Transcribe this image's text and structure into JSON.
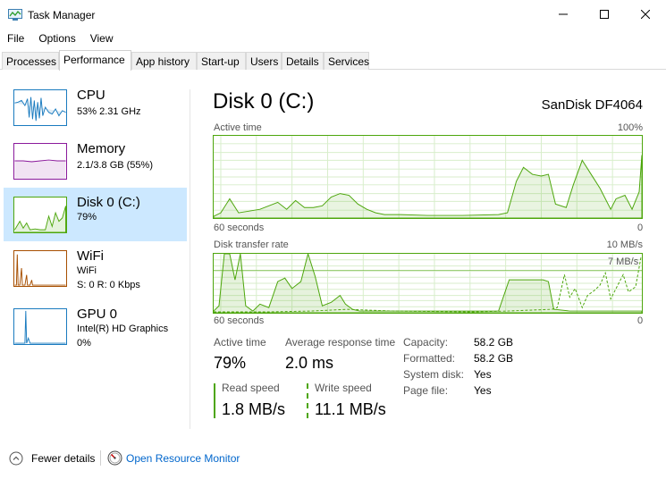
{
  "window": {
    "title": "Task Manager"
  },
  "menu": [
    "File",
    "Options",
    "View"
  ],
  "tabs": [
    "Processes",
    "Performance",
    "App history",
    "Start-up",
    "Users",
    "Details",
    "Services"
  ],
  "sidebar": {
    "items": [
      {
        "name": "CPU",
        "line1": "53% 2.31 GHz",
        "line2": ""
      },
      {
        "name": "Memory",
        "line1": "2.1/3.8 GB (55%)",
        "line2": ""
      },
      {
        "name": "Disk 0 (C:)",
        "line1": "79%",
        "line2": ""
      },
      {
        "name": "WiFi",
        "line1": "WiFi",
        "line2": "S: 0 R: 0 Kbps"
      },
      {
        "name": "GPU 0",
        "line1": "Intel(R) HD Graphics",
        "line2": "0%"
      }
    ]
  },
  "main": {
    "title": "Disk 0 (C:)",
    "model": "SanDisk DF4064",
    "graph1": {
      "label": "Active time",
      "max": "100%",
      "time": "60 seconds",
      "min": "0"
    },
    "graph2": {
      "label": "Disk transfer rate",
      "max": "10 MB/s",
      "marker": "7 MB/s",
      "time": "60 seconds",
      "min": "0"
    },
    "stats": {
      "active_time_label": "Active time",
      "active_time_value": "79%",
      "avg_response_label": "Average response time",
      "avg_response_value": "2.0 ms",
      "read_label": "Read speed",
      "read_value": "1.8 MB/s",
      "write_label": "Write speed",
      "write_value": "11.1 MB/s"
    },
    "properties": [
      {
        "label": "Capacity:",
        "value": "58.2 GB"
      },
      {
        "label": "Formatted:",
        "value": "58.2 GB"
      },
      {
        "label": "System disk:",
        "value": "Yes"
      },
      {
        "label": "Page file:",
        "value": "Yes"
      }
    ]
  },
  "footer": {
    "fewer_details": "Fewer details",
    "resource_monitor": "Open Resource Monitor"
  },
  "colors": {
    "disk_green": "#4da60c",
    "cpu_blue": "#1a7bbf",
    "memory_purple": "#8b1a9c",
    "wifi_orange": "#a74f01",
    "selected_bg": "#cce8ff",
    "link": "#0066cc"
  }
}
